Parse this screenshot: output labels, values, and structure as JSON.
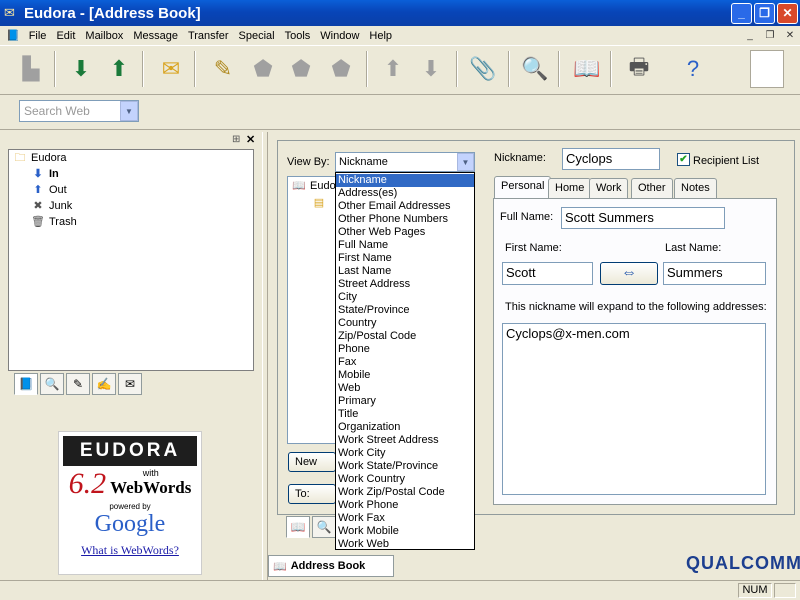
{
  "window": {
    "title": "Eudora - [Address Book]"
  },
  "menu": [
    "File",
    "Edit",
    "Mailbox",
    "Message",
    "Transfer",
    "Special",
    "Tools",
    "Window",
    "Help"
  ],
  "search": {
    "placeholder": "Search Web"
  },
  "mailboxes": {
    "root": "Eudora",
    "items": [
      "In",
      "Out",
      "Junk",
      "Trash"
    ]
  },
  "ad": {
    "brand": "EUDORA",
    "version": "6.2",
    "with": "with",
    "product": "WebWords",
    "powered_by": "powered by",
    "google": "Google",
    "link": "What is WebWords?"
  },
  "address_book": {
    "view_by_label": "View By:",
    "view_by_value": "Nickname",
    "tree_root": "Eudo",
    "new_button": "New",
    "to_button": "To:",
    "view_options": [
      "Nickname",
      "Address(es)",
      "Other Email Addresses",
      "Other Phone Numbers",
      "Other Web Pages",
      "Full Name",
      "First Name",
      "Last Name",
      "Street Address",
      "City",
      "State/Province",
      "Country",
      "Zip/Postal Code",
      "Phone",
      "Fax",
      "Mobile",
      "Web",
      "Primary",
      "Title",
      "Organization",
      "Work Street Address",
      "Work City",
      "Work State/Province",
      "Work Country",
      "Work Zip/Postal Code",
      "Work Phone",
      "Work Fax",
      "Work Mobile",
      "Work Web"
    ],
    "selected_option": "Nickname"
  },
  "entry": {
    "nickname_label": "Nickname:",
    "nickname": "Cyclops",
    "recipient_list_label": "Recipient List",
    "recipient_list_checked": true,
    "tabs": [
      "Personal",
      "Home",
      "Work",
      "Other",
      "Notes"
    ],
    "active_tab": "Personal",
    "full_name_label": "Full Name:",
    "full_name": "Scott Summers",
    "first_name_label": "First Name:",
    "first_name": "Scott",
    "last_name_label": "Last Name:",
    "last_name": "Summers",
    "expand_note": "This nickname will expand to the following addresses:",
    "addresses": "Cyclops@x-men.com"
  },
  "taskbar": {
    "address_book_button": "Address Book"
  },
  "branding": {
    "qualcomm": "QUALCOMM"
  },
  "status": {
    "num": "NUM"
  }
}
